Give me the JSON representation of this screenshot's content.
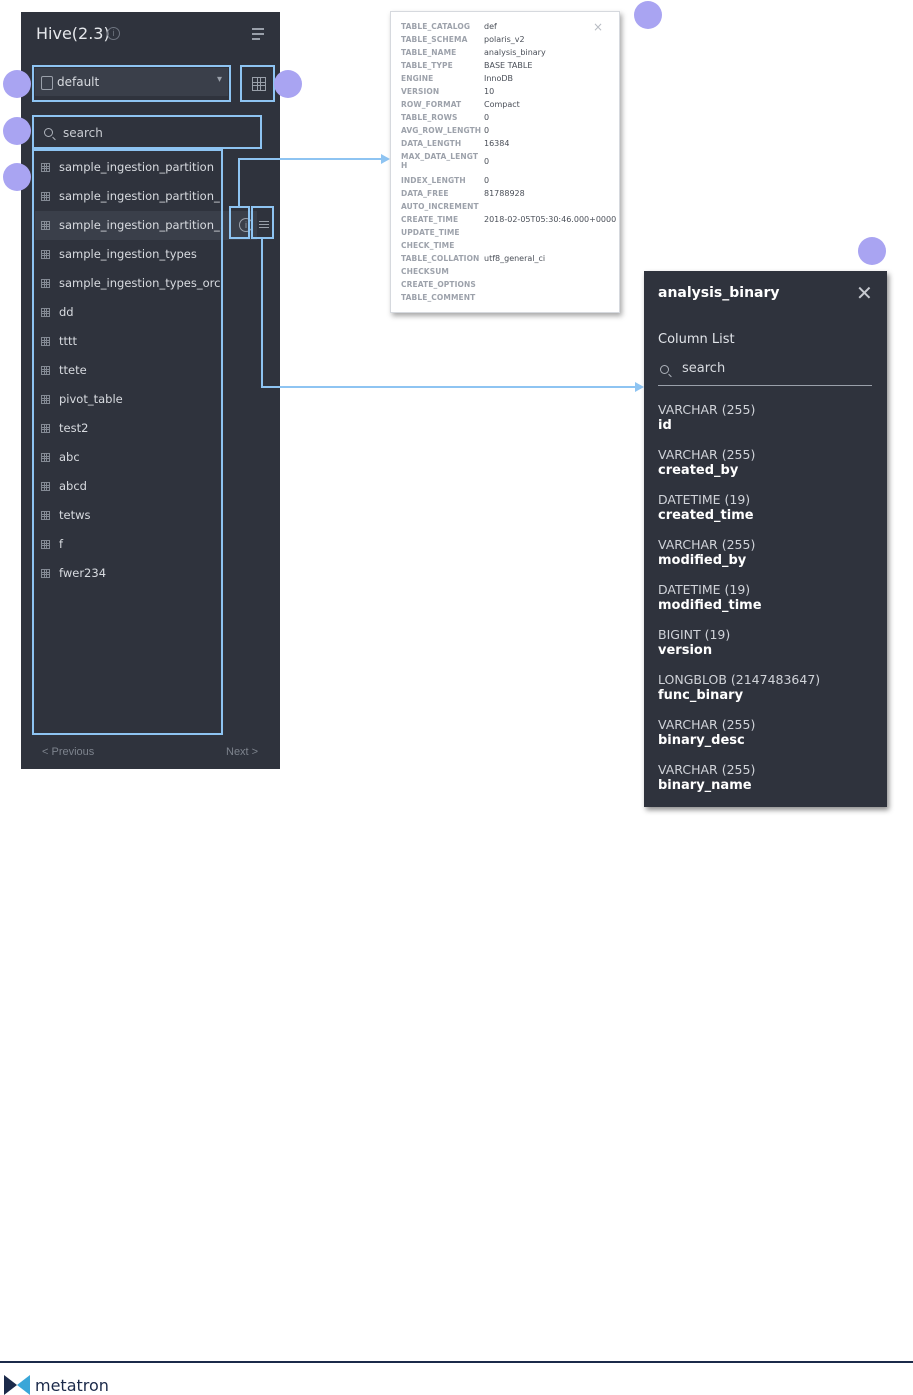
{
  "panel": {
    "title": "Hive(2.3)",
    "database": "default",
    "search_placeholder": "search",
    "tables": [
      "sample_ingestion_partition",
      "sample_ingestion_partition_...",
      "sample_ingestion_partition_...",
      "sample_ingestion_types",
      "sample_ingestion_types_orc",
      "dd",
      "tttt",
      "ttete",
      "pivot_table",
      "test2",
      "abc",
      "abcd",
      "tetws",
      "f",
      "fwer234"
    ],
    "prev_label": "< Previous",
    "next_label": "Next >"
  },
  "info_popup": {
    "close_label": "×",
    "fields": [
      {
        "key": "TABLE_CATALOG",
        "value": "def"
      },
      {
        "key": "TABLE_SCHEMA",
        "value": "polaris_v2"
      },
      {
        "key": "TABLE_NAME",
        "value": "analysis_binary"
      },
      {
        "key": "TABLE_TYPE",
        "value": "BASE TABLE"
      },
      {
        "key": "ENGINE",
        "value": "InnoDB"
      },
      {
        "key": "VERSION",
        "value": "10"
      },
      {
        "key": "ROW_FORMAT",
        "value": "Compact"
      },
      {
        "key": "TABLE_ROWS",
        "value": "0"
      },
      {
        "key": "AVG_ROW_LENGTH",
        "value": "0"
      },
      {
        "key": "DATA_LENGTH",
        "value": "16384"
      },
      {
        "key": "MAX_DATA_LENGT H",
        "value": "0"
      },
      {
        "key": "INDEX_LENGTH",
        "value": "0"
      },
      {
        "key": "DATA_FREE",
        "value": "81788928"
      },
      {
        "key": "AUTO_INCREMENT",
        "value": ""
      },
      {
        "key": "CREATE_TIME",
        "value": "2018-02-05T05:30:46.000+0000"
      },
      {
        "key": "UPDATE_TIME",
        "value": ""
      },
      {
        "key": "CHECK_TIME",
        "value": ""
      },
      {
        "key": "TABLE_COLLATION",
        "value": "utf8_general_ci"
      },
      {
        "key": "CHECKSUM",
        "value": ""
      },
      {
        "key": "CREATE_OPTIONS",
        "value": ""
      },
      {
        "key": "TABLE_COMMENT",
        "value": ""
      }
    ]
  },
  "column_popup": {
    "title": "analysis_binary",
    "close_label": "✕",
    "list_label": "Column List",
    "search_placeholder": "search",
    "columns": [
      {
        "type": "VARCHAR (255)",
        "name": "id"
      },
      {
        "type": "VARCHAR (255)",
        "name": "created_by"
      },
      {
        "type": "DATETIME (19)",
        "name": "created_time"
      },
      {
        "type": "VARCHAR (255)",
        "name": "modified_by"
      },
      {
        "type": "DATETIME (19)",
        "name": "modified_time"
      },
      {
        "type": "BIGINT (19)",
        "name": "version"
      },
      {
        "type": "LONGBLOB (2147483647)",
        "name": "func_binary"
      },
      {
        "type": "VARCHAR (255)",
        "name": "binary_desc"
      },
      {
        "type": "VARCHAR (255)",
        "name": "binary_name"
      }
    ]
  },
  "footer": {
    "brand": "metatron"
  },
  "colors": {
    "panel_bg": "#2f333d",
    "highlight": "#8ec4f2",
    "badge": "#a9a4f2",
    "brand": "#1b2a4a"
  }
}
